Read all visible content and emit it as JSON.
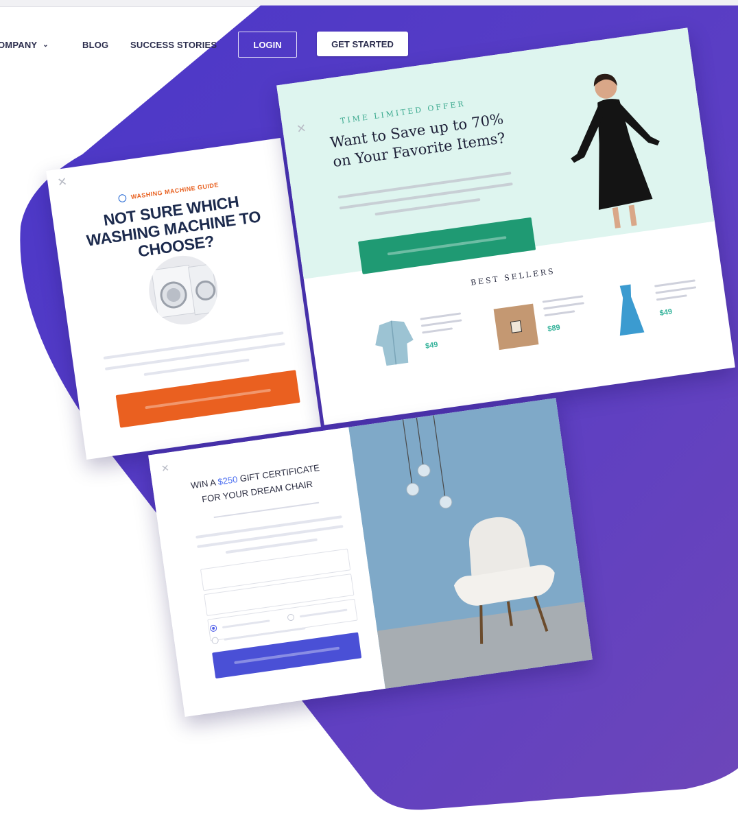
{
  "colors": {
    "accent_purple": "#5a3fc0",
    "orange": "#ea6020",
    "green": "#1f9a73",
    "blue": "#4a50d6",
    "mint": "#def5ef"
  },
  "nav": {
    "company_label": "OMPANY",
    "company_icon": "chevron-down-icon",
    "blog_label": "BLOG",
    "success_label": "SUCCESS STORIES",
    "login_label": "LOGIN",
    "get_started_label": "GET STARTED"
  },
  "washing_card": {
    "tag": "WASHING MACHINE GUIDE",
    "title": "NOT SURE WHICH WASHING MACHINE TO CHOOSE?",
    "close_icon": "close-icon",
    "drop_icon": "water-drop-icon"
  },
  "sale_card": {
    "tag": "TIME LIMITED OFFER",
    "title": "Want to Save up to 70% on Your Favorite Items?",
    "best_sellers": "BEST SELLERS",
    "products": [
      {
        "name": "blouse-thumbnail",
        "price": "$49"
      },
      {
        "name": "tshirt-thumbnail",
        "price": "$89"
      },
      {
        "name": "dress-thumbnail",
        "price": "$49"
      }
    ]
  },
  "chair_card": {
    "title_pre": "WIN A ",
    "amount": "$250",
    "title_post": " GIFT CERTIFICATE FOR YOUR DREAM CHAIR"
  }
}
